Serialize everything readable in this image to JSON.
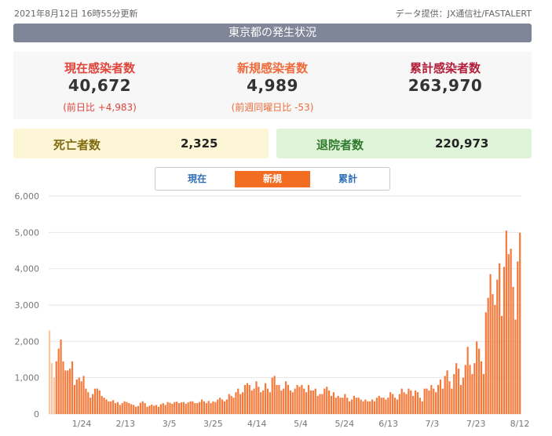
{
  "header": {
    "updated": "2021年8月12日 16時55分更新",
    "source": "データ提供：JX通信社/FASTALERT",
    "title": "東京都の発生状況"
  },
  "summary": [
    {
      "label": "現在感染者数",
      "value": "40,672",
      "sub": "(前日比 +4,983)"
    },
    {
      "label": "新規感染者数",
      "value": "4,989",
      "sub": "(前週同曜日比 -53)"
    },
    {
      "label": "累計感染者数",
      "value": "263,970",
      "sub": ""
    }
  ],
  "deaths": {
    "label": "死亡者数",
    "value": "2,325"
  },
  "discharged": {
    "label": "退院者数",
    "value": "220,973"
  },
  "tabs": [
    {
      "label": "現在",
      "active": false
    },
    {
      "label": "新規",
      "active": true
    },
    {
      "label": "累計",
      "active": false
    }
  ],
  "colors": {
    "bar": "#f4793a",
    "bar_light": "#f9c6a3",
    "grid": "#e6e6e6",
    "tab_active": "#f26d21"
  },
  "chart_data": {
    "type": "bar",
    "ylim": [
      0,
      6000
    ],
    "yticks": [
      "0",
      "1,000",
      "2,000",
      "3,000",
      "4,000",
      "5,000",
      "6,000"
    ],
    "xticks": [
      "1/24",
      "2/13",
      "3/5",
      "3/25",
      "4/14",
      "5/4",
      "5/24",
      "6/13",
      "7/3",
      "7/23",
      "8/12"
    ],
    "values": [
      2300,
      1400,
      1000,
      1450,
      1800,
      2050,
      1450,
      1200,
      1200,
      1250,
      1450,
      800,
      950,
      1000,
      900,
      1050,
      700,
      600,
      450,
      550,
      700,
      700,
      650,
      500,
      450,
      400,
      350,
      350,
      380,
      300,
      330,
      250,
      300,
      350,
      330,
      300,
      270,
      250,
      200,
      220,
      310,
      350,
      300,
      200,
      230,
      260,
      230,
      250,
      200,
      270,
      300,
      250,
      330,
      310,
      280,
      330,
      340,
      300,
      320,
      330,
      280,
      320,
      350,
      350,
      300,
      300,
      330,
      400,
      350,
      300,
      360,
      300,
      350,
      330,
      400,
      450,
      400,
      350,
      400,
      550,
      500,
      450,
      600,
      700,
      550,
      600,
      800,
      850,
      800,
      650,
      700,
      900,
      750,
      600,
      650,
      850,
      700,
      600,
      1000,
      1050,
      800,
      800,
      650,
      700,
      900,
      800,
      650,
      600,
      700,
      800,
      750,
      800,
      700,
      600,
      800,
      650,
      650,
      700,
      500,
      550,
      550,
      700,
      750,
      650,
      500,
      600,
      450,
      500,
      450,
      450,
      550,
      450,
      350,
      400,
      500,
      450,
      450,
      400,
      350,
      400,
      350,
      350,
      400,
      350,
      450,
      500,
      450,
      450,
      400,
      450,
      600,
      550,
      450,
      400,
      550,
      700,
      600,
      550,
      700,
      650,
      500,
      650,
      600,
      450,
      350,
      700,
      700,
      650,
      800,
      700,
      600,
      800,
      950,
      700,
      1050,
      1200,
      900,
      700,
      1100,
      1400,
      1250,
      800,
      1000,
      1350,
      1850,
      1350,
      1100,
      1400,
      2000,
      1800,
      1450,
      1100,
      2800,
      3200,
      3850,
      3300,
      3000,
      3700,
      4150,
      2700,
      4050,
      5050,
      4400,
      4550,
      3500,
      2600,
      4200,
      4989
    ]
  }
}
